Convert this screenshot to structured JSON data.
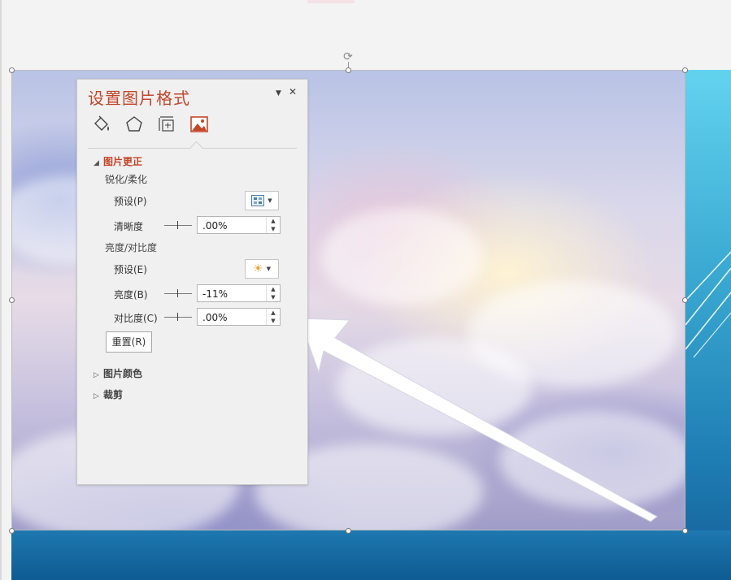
{
  "panel": {
    "title": "设置图片格式",
    "dropdown_glyph": "▼",
    "close_glyph": "✕",
    "tabs": [
      {
        "name": "fill-line",
        "icon": "paint-bucket-icon"
      },
      {
        "name": "effects",
        "icon": "pentagon-icon"
      },
      {
        "name": "size-position",
        "icon": "size-position-icon"
      },
      {
        "name": "picture",
        "icon": "picture-icon",
        "active": true
      }
    ],
    "sections": {
      "correction": {
        "title": "图片更正",
        "expanded": true,
        "sharpen": {
          "heading": "锐化/柔化",
          "preset_label": "预设(P)",
          "clarity_label": "清晰度",
          "clarity_value": ".00%"
        },
        "brightness_contrast": {
          "heading": "亮度/对比度",
          "preset_label": "预设(E)",
          "brightness_label": "亮度(B)",
          "brightness_value": "-11%",
          "contrast_label": "对比度(C)",
          "contrast_value": ".00%"
        },
        "reset_label": "重置(R)"
      },
      "color": {
        "title": "图片颜色",
        "expanded": false
      },
      "crop": {
        "title": "裁剪",
        "expanded": false
      }
    }
  },
  "colors": {
    "accent": "#c4462a",
    "panel_bg": "#f0f0f0",
    "slide_blue": "#2b8fc6"
  }
}
